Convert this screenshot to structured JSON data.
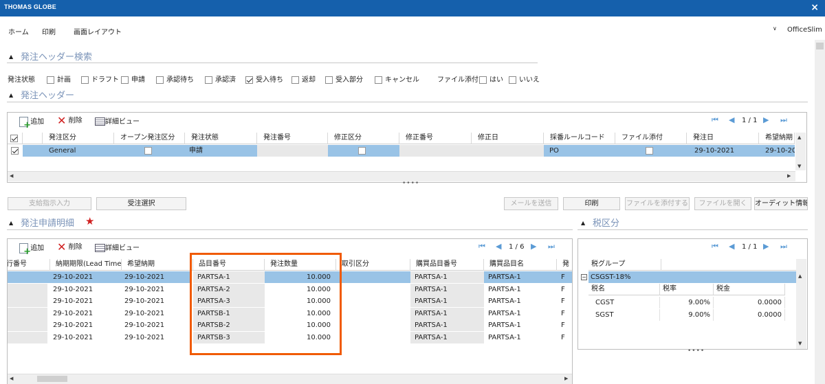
{
  "app": {
    "title": "THOMAS GLOBE",
    "close": "×"
  },
  "menu": {
    "items": [
      "ホーム",
      "印刷",
      "画面レイアウト"
    ],
    "theme": "OfficeSlim"
  },
  "search": {
    "title": "発注ヘッダー検索",
    "status_label": "発注状態",
    "filters": [
      {
        "label": "計画",
        "checked": false
      },
      {
        "label": "ドラフト",
        "checked": false
      },
      {
        "label": "申請",
        "checked": false
      },
      {
        "label": "承認待ち",
        "checked": false
      },
      {
        "label": "承認済",
        "checked": false
      },
      {
        "label": "受入待ち",
        "checked": true
      },
      {
        "label": "返却",
        "checked": false
      },
      {
        "label": "受入部分",
        "checked": false
      },
      {
        "label": "キャンセル",
        "checked": false
      }
    ],
    "attach_label": "ファイル添付",
    "attach_options": [
      {
        "label": "はい",
        "checked": false
      },
      {
        "label": "いいえ",
        "checked": false
      }
    ]
  },
  "header": {
    "title": "発注ヘッダー",
    "toolbar": {
      "add": "追加",
      "delete": "削除",
      "detail": "詳細ビュー",
      "page": "1 / 1"
    },
    "columns": [
      "発注区分",
      "オープン発注区分",
      "発注状態",
      "発注番号",
      "修正区分",
      "修正番号",
      "修正日",
      "採番ルールコード",
      "ファイル添付",
      "発注日",
      "希望納期"
    ],
    "row": {
      "type": "General",
      "status": "申請",
      "rule": "PO",
      "order_date": "29-10-2021",
      "due": "29-10-20"
    }
  },
  "grip": "••••",
  "actions": {
    "supply": "支給指示入力",
    "receive_select": "受注選択",
    "send_mail": "メールを送信",
    "print": "印刷",
    "attach_file": "ファイルを添付する",
    "open_file": "ファイルを開く",
    "audit": "オーディット情報"
  },
  "detail": {
    "title": "発注申請明細",
    "required": "★",
    "toolbar": {
      "add": "追加",
      "delete": "削除",
      "detail": "詳細ビュー",
      "page": "1 / 6"
    },
    "columns": [
      "行番号",
      "納期期限(Lead Time)",
      "希望納期",
      "品目番号",
      "発注数量",
      "取引区分",
      "購買品目番号",
      "購買品目名",
      "発"
    ],
    "rows": [
      {
        "lead": "29-10-2021",
        "due": "29-10-2021",
        "item": "PARTSA-1",
        "qty": "10.000",
        "pitem": "PARTSA-1",
        "pname": "PARTSA-1"
      },
      {
        "lead": "29-10-2021",
        "due": "29-10-2021",
        "item": "PARTSA-2",
        "qty": "10.000",
        "pitem": "PARTSA-1",
        "pname": "PARTSA-1"
      },
      {
        "lead": "29-10-2021",
        "due": "29-10-2021",
        "item": "PARTSA-3",
        "qty": "10.000",
        "pitem": "PARTSA-1",
        "pname": "PARTSA-1"
      },
      {
        "lead": "29-10-2021",
        "due": "29-10-2021",
        "item": "PARTSB-1",
        "qty": "10.000",
        "pitem": "PARTSA-1",
        "pname": "PARTSA-1"
      },
      {
        "lead": "29-10-2021",
        "due": "29-10-2021",
        "item": "PARTSB-2",
        "qty": "10.000",
        "pitem": "PARTSA-1",
        "pname": "PARTSA-1"
      },
      {
        "lead": "29-10-2021",
        "due": "29-10-2021",
        "item": "PARTSB-3",
        "qty": "10.000",
        "pitem": "PARTSA-1",
        "pname": "PARTSA-1"
      }
    ],
    "trunc": "F"
  },
  "tax": {
    "title": "税区分",
    "page": "1 / 1",
    "group_col": "税グループ",
    "group": "CSGST-18%",
    "sub_cols": [
      "税名",
      "税率",
      "税金"
    ],
    "rows": [
      {
        "name": "CGST",
        "rate": "9.00%",
        "amount": "0.0000"
      },
      {
        "name": "SGST",
        "rate": "9.00%",
        "amount": "0.0000"
      }
    ]
  },
  "colors": {
    "titlebar": "#1560ac",
    "selected": "#99c3e6",
    "highlight": "#f05a00",
    "section": "#7a93b8"
  }
}
